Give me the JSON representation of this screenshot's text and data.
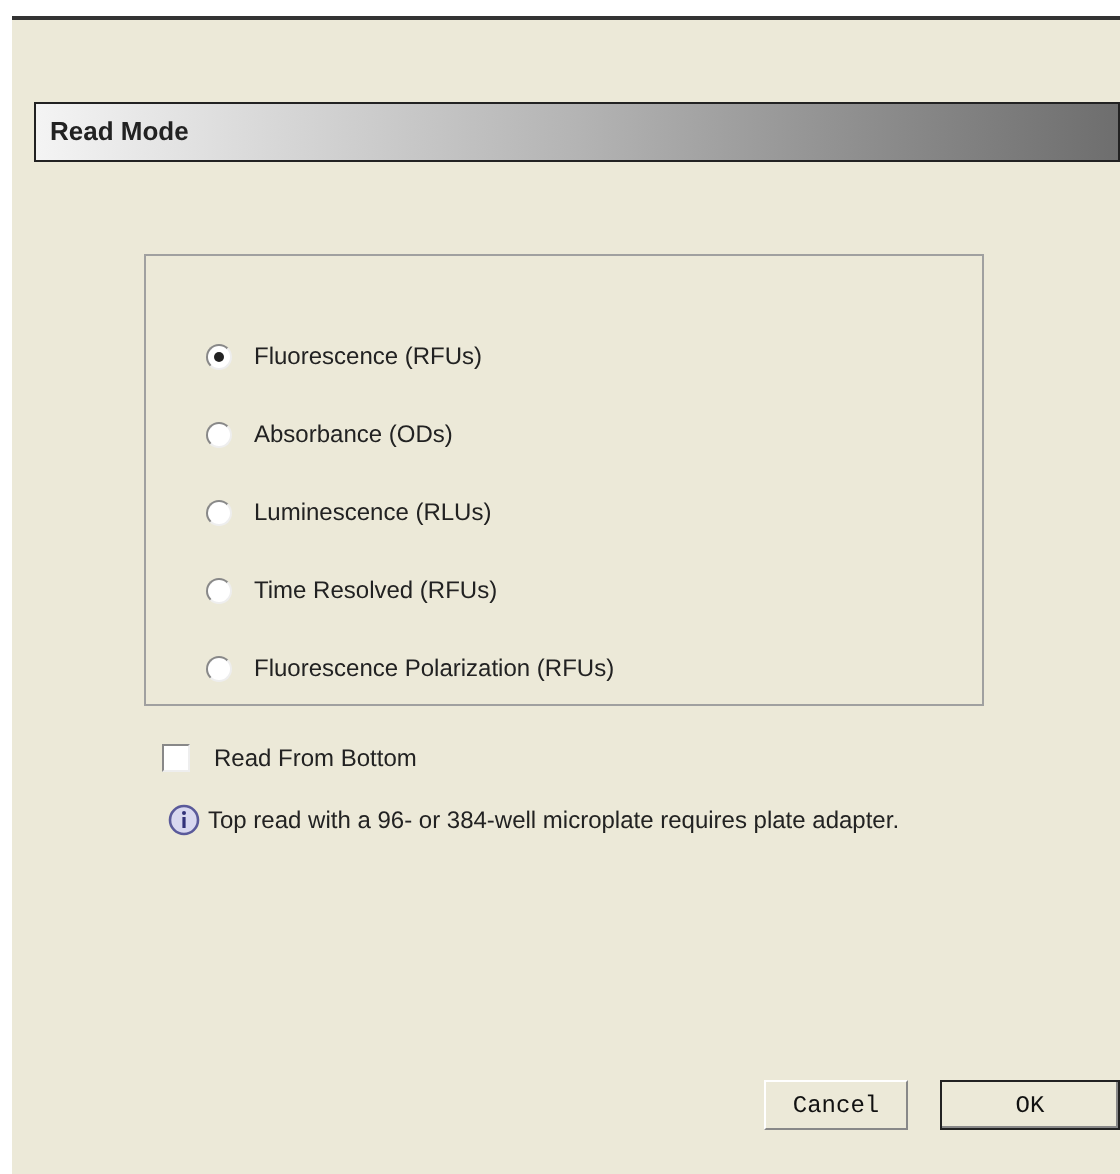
{
  "section": {
    "title": "Read Mode"
  },
  "read_modes": [
    {
      "label": "Fluorescence (RFUs)",
      "selected": true
    },
    {
      "label": "Absorbance (ODs)",
      "selected": false
    },
    {
      "label": "Luminescence (RLUs)",
      "selected": false
    },
    {
      "label": "Time Resolved (RFUs)",
      "selected": false
    },
    {
      "label": "Fluorescence Polarization (RFUs)",
      "selected": false
    }
  ],
  "read_from_bottom": {
    "label": "Read From Bottom",
    "checked": false
  },
  "info_note": "Top read with a 96- or 384-well microplate requires plate adapter.",
  "buttons": [
    {
      "label": "Cancel",
      "default": false
    },
    {
      "label": "OK",
      "default": true
    }
  ]
}
